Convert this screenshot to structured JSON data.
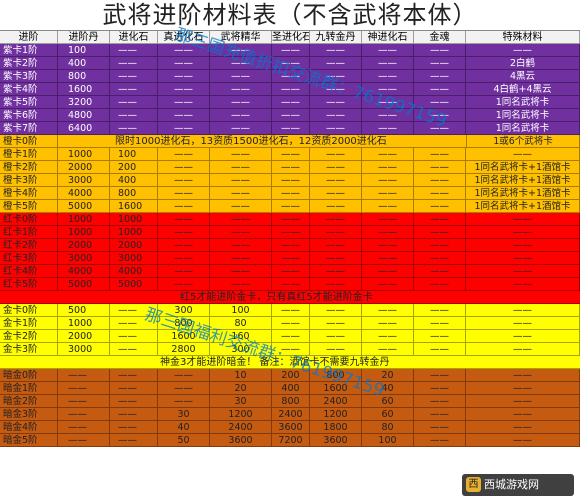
{
  "title": "武将进阶材料表（不含武将本体）",
  "headers": [
    "进阶",
    "进阶丹",
    "进化石",
    "真进化石",
    "武将精华",
    "圣进化石",
    "九转金丹",
    "神进化石",
    "金魂",
    "特殊材料"
  ],
  "purple_rows": [
    [
      "紫卡1阶",
      "100",
      "——",
      "——",
      "——",
      "——",
      "——",
      "——",
      "——",
      "——"
    ],
    [
      "紫卡2阶",
      "400",
      "——",
      "——",
      "——",
      "——",
      "——",
      "——",
      "——",
      "2白鹤"
    ],
    [
      "紫卡3阶",
      "800",
      "——",
      "——",
      "——",
      "——",
      "——",
      "——",
      "——",
      "4黑云"
    ],
    [
      "紫卡4阶",
      "1600",
      "——",
      "——",
      "——",
      "——",
      "——",
      "——",
      "——",
      "4白鹤+4黑云"
    ],
    [
      "紫卡5阶",
      "3200",
      "——",
      "——",
      "——",
      "——",
      "——",
      "——",
      "——",
      "1同名武将卡"
    ],
    [
      "紫卡6阶",
      "4800",
      "——",
      "——",
      "——",
      "——",
      "——",
      "——",
      "——",
      "1同名武将卡"
    ],
    [
      "紫卡7阶",
      "6400",
      "——",
      "——",
      "——",
      "——",
      "——",
      "——",
      "——",
      "1同名武将卡"
    ]
  ],
  "orange_note_row": {
    "label": "橙卡0阶",
    "note": "限时1000进化石，13资质1500进化石，12资质2000进化石",
    "special": "1或6个武将卡"
  },
  "orange_rows": [
    [
      "橙卡1阶",
      "1000",
      "100",
      "——",
      "——",
      "——",
      "——",
      "——",
      "——",
      "——"
    ],
    [
      "橙卡2阶",
      "2000",
      "200",
      "——",
      "——",
      "——",
      "——",
      "——",
      "——",
      "1同名武将卡+1酒馆卡"
    ],
    [
      "橙卡3阶",
      "3000",
      "400",
      "——",
      "——",
      "——",
      "——",
      "——",
      "——",
      "1同名武将卡+1酒馆卡"
    ],
    [
      "橙卡4阶",
      "4000",
      "800",
      "——",
      "——",
      "——",
      "——",
      "——",
      "——",
      "1同名武将卡+1酒馆卡"
    ],
    [
      "橙卡5阶",
      "5000",
      "1600",
      "——",
      "——",
      "——",
      "——",
      "——",
      "——",
      "1同名武将卡+1酒馆卡"
    ]
  ],
  "red_rows": [
    [
      "红卡0阶",
      "1000",
      "1000",
      "——",
      "——",
      "——",
      "——",
      "——",
      "——",
      "——"
    ],
    [
      "红卡1阶",
      "1000",
      "1000",
      "——",
      "——",
      "——",
      "——",
      "——",
      "——",
      "——"
    ],
    [
      "红卡2阶",
      "2000",
      "2000",
      "——",
      "——",
      "——",
      "——",
      "——",
      "——",
      "——"
    ],
    [
      "红卡3阶",
      "3000",
      "3000",
      "——",
      "——",
      "——",
      "——",
      "——",
      "——",
      "——"
    ],
    [
      "红卡4阶",
      "4000",
      "4000",
      "——",
      "——",
      "——",
      "——",
      "——",
      "——",
      "——"
    ],
    [
      "红卡5阶",
      "5000",
      "5000",
      "——",
      "——",
      "——",
      "——",
      "——",
      "——",
      "——"
    ]
  ],
  "red_gold_note": "红5才能进阶金卡，只有真红5才能进阶金卡",
  "gold_rows": [
    [
      "金卡0阶",
      "500",
      "——",
      "300",
      "100",
      "——",
      "——",
      "——",
      "——",
      "——"
    ],
    [
      "金卡1阶",
      "1000",
      "——",
      "800",
      "80",
      "——",
      "——",
      "——",
      "——",
      "——"
    ],
    [
      "金卡2阶",
      "2000",
      "——",
      "1600",
      "160",
      "——",
      "——",
      "——",
      "——",
      "——"
    ],
    [
      "金卡3阶",
      "3000",
      "——",
      "2800",
      "300",
      "——",
      "——",
      "——",
      "——",
      "——"
    ]
  ],
  "gold_dark_note": "神金3才能进阶暗金！ 备注：酒馆卡不需要九转金丹",
  "dark_rows": [
    [
      "暗金0阶",
      "——",
      "——",
      "——",
      "10",
      "200",
      "800",
      "20",
      "——",
      "——"
    ],
    [
      "暗金1阶",
      "——",
      "——",
      "——",
      "20",
      "400",
      "1600",
      "40",
      "——",
      "——"
    ],
    [
      "暗金2阶",
      "——",
      "——",
      "——",
      "30",
      "800",
      "2400",
      "60",
      "——",
      "——"
    ],
    [
      "暗金3阶",
      "——",
      "——",
      "30",
      "1200",
      "2400",
      "1200",
      "60",
      "——",
      "——"
    ],
    [
      "暗金4阶",
      "——",
      "——",
      "40",
      "2400",
      "3600",
      "1800",
      "80",
      "——",
      "——"
    ],
    [
      "暗金5阶",
      "——",
      "——",
      "50",
      "3600",
      "7200",
      "3600",
      "100",
      "——",
      "——"
    ]
  ],
  "watermarks": [
    "那三国充值折扣交流群：761997159",
    "那三国福利交流群：761997159"
  ],
  "logo_text": "西城游戏网",
  "colors": {
    "purple": "#7030a0",
    "orange": "#ffc000",
    "red": "#ff0000",
    "yellow": "#ffff00",
    "brown": "#c55a11",
    "watermark": "#0078d2"
  }
}
